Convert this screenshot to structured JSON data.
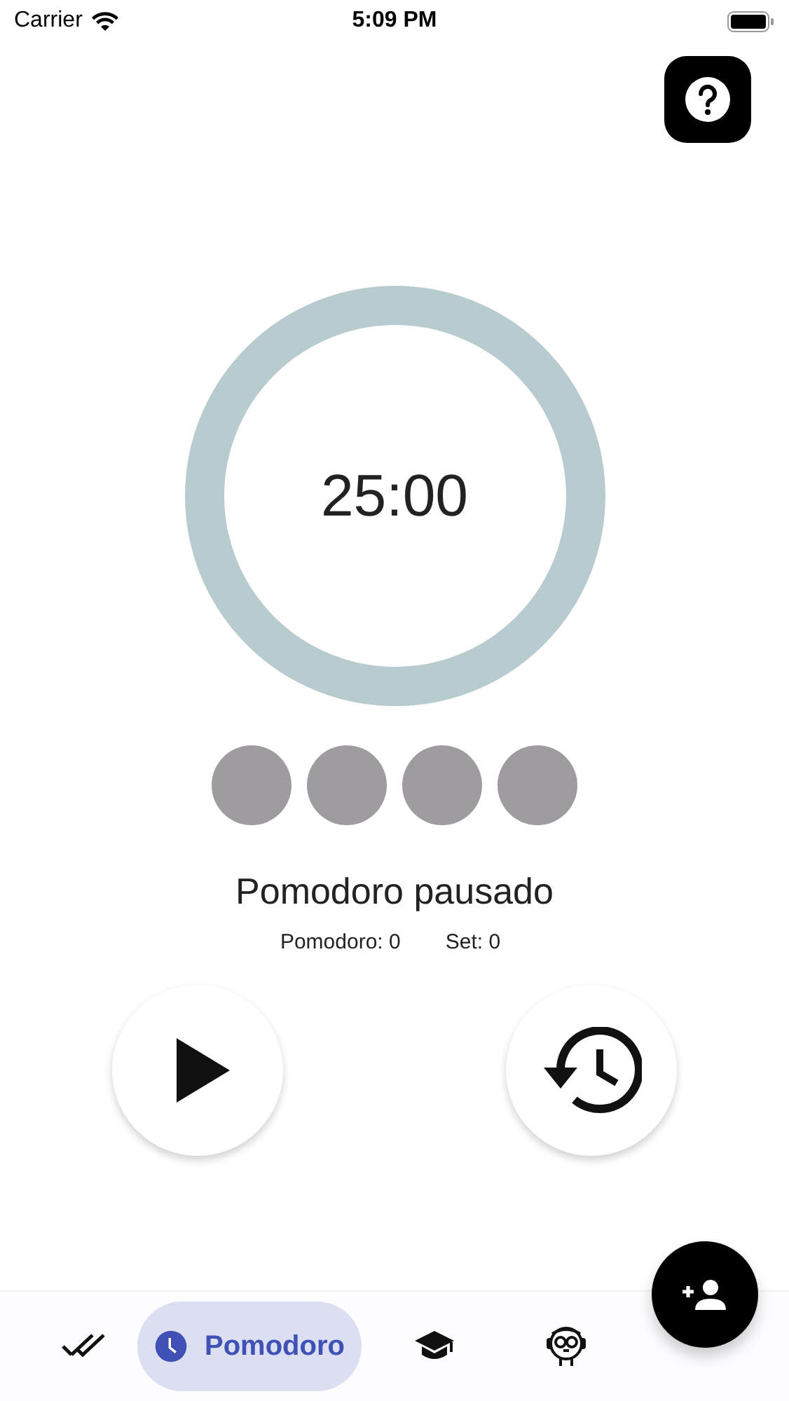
{
  "status_bar": {
    "carrier": "Carrier",
    "time": "5:09 PM"
  },
  "timer": {
    "time": "25:00",
    "level": 0
  },
  "sessions": [
    {
      "done": false
    },
    {
      "done": false
    },
    {
      "done": false
    },
    {
      "done": false
    }
  ],
  "state_label": "Pomodoro pausado",
  "counters": [
    {
      "label": "Pomodoro: 0"
    },
    {
      "label": "Set: 0"
    }
  ],
  "controls": [
    {
      "kind": "play"
    },
    {
      "kind": "reset"
    }
  ],
  "nav": [
    {
      "kind": "tasks",
      "selected": false
    },
    {
      "kind": "pomodoro",
      "label": "Pomodoro",
      "selected": true
    },
    {
      "kind": "study",
      "selected": false
    },
    {
      "kind": "monkey",
      "selected": false
    }
  ]
}
